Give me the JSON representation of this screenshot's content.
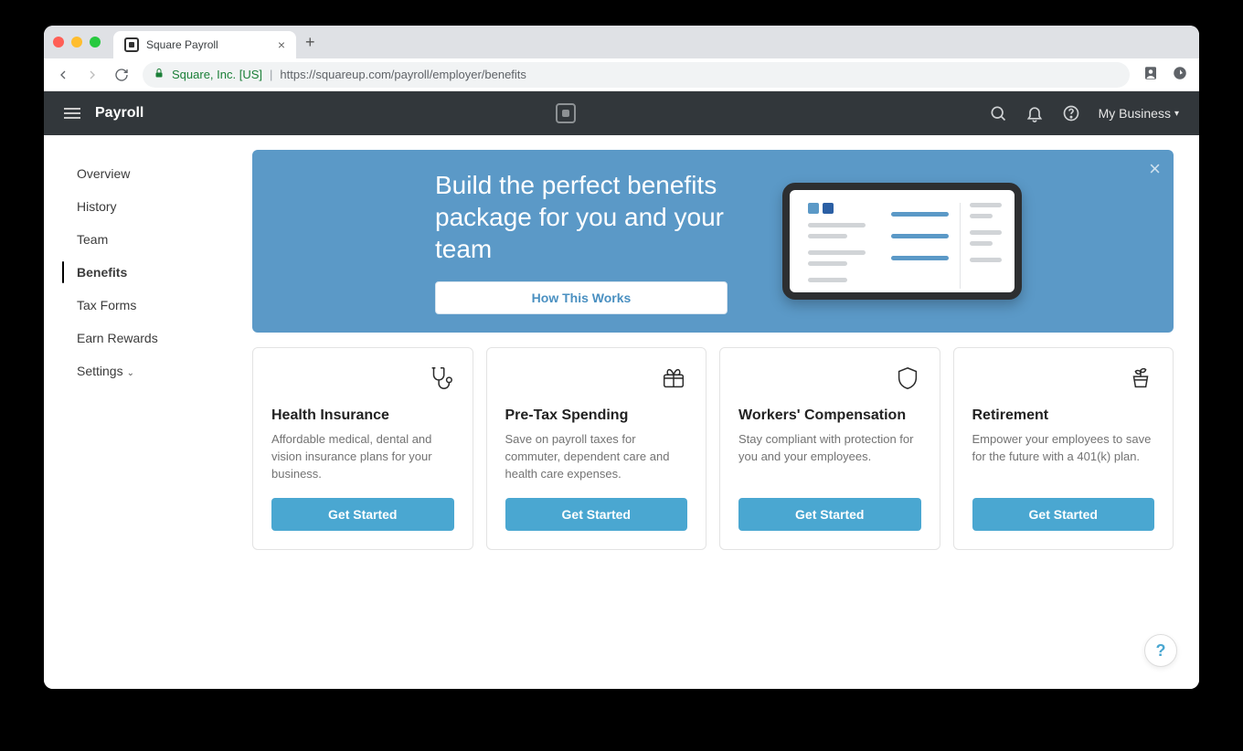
{
  "browser": {
    "tab_title": "Square Payroll",
    "org_label": "Square, Inc. [US]",
    "url": "https://squareup.com/payroll/employer/benefits"
  },
  "header": {
    "app_title": "Payroll",
    "business_label": "My Business"
  },
  "sidebar": {
    "items": [
      {
        "label": "Overview"
      },
      {
        "label": "History"
      },
      {
        "label": "Team"
      },
      {
        "label": "Benefits"
      },
      {
        "label": "Tax Forms"
      },
      {
        "label": "Earn Rewards"
      },
      {
        "label": "Settings"
      }
    ]
  },
  "hero": {
    "headline": "Build the perfect benefits package for you and your team",
    "cta": "How This Works"
  },
  "cards": [
    {
      "title": "Health Insurance",
      "desc": "Affordable medical, dental and vision insurance plans for your business.",
      "cta": "Get Started"
    },
    {
      "title": "Pre-Tax Spending",
      "desc": "Save on payroll taxes for commuter, dependent care and health care expenses.",
      "cta": "Get Started"
    },
    {
      "title": "Workers' Compensation",
      "desc": "Stay compliant with protection for you and your employees.",
      "cta": "Get Started"
    },
    {
      "title": "Retirement",
      "desc": "Empower your employees to save for the future with a 401(k) plan.",
      "cta": "Get Started"
    }
  ],
  "help": {
    "label": "?"
  }
}
